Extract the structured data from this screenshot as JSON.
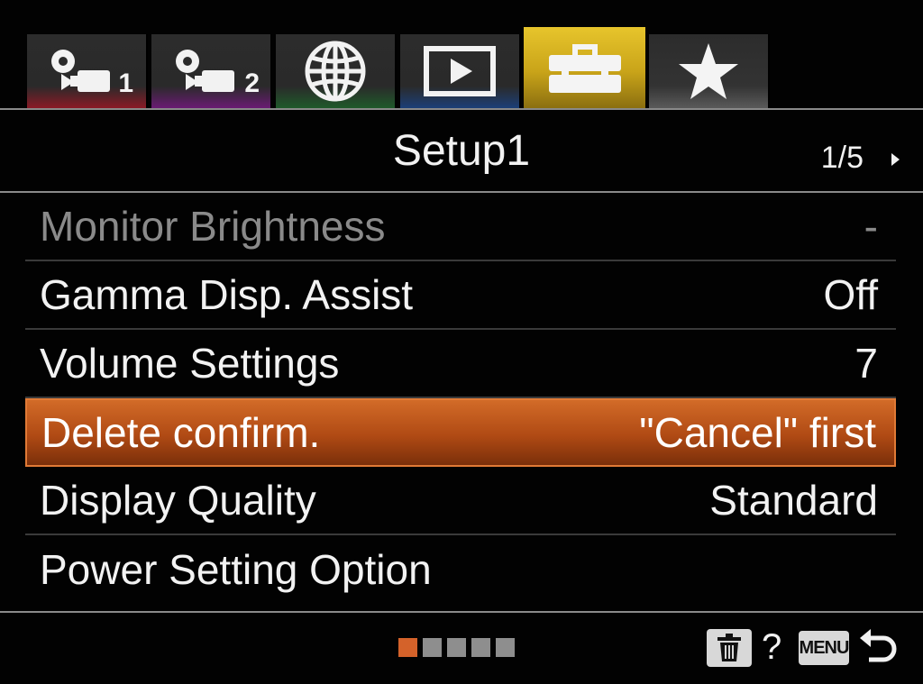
{
  "tabs": [
    {
      "icon": "camera-settings-icon",
      "number": "1",
      "color": "#8b1a26"
    },
    {
      "icon": "camera-settings-icon",
      "number": "2",
      "color": "#6a1b73"
    },
    {
      "icon": "globe-icon",
      "number": "",
      "color": "#1f5a2a"
    },
    {
      "icon": "playback-icon",
      "number": "",
      "color": "#1c3f78"
    },
    {
      "icon": "toolbox-icon",
      "number": "",
      "color": "#e7c52c",
      "active": true
    },
    {
      "icon": "star-icon",
      "number": "",
      "color": "#5a5a5a"
    }
  ],
  "header": {
    "title": "Setup1",
    "page": "1/5"
  },
  "menu": {
    "items": [
      {
        "label": "Monitor Brightness",
        "value": "-",
        "state": "disabled"
      },
      {
        "label": "Gamma Disp. Assist",
        "value": "Off",
        "state": "normal"
      },
      {
        "label": "Volume Settings",
        "value": "7",
        "state": "normal"
      },
      {
        "label": "Delete confirm.",
        "value": "\"Cancel\" first",
        "state": "selected"
      },
      {
        "label": "Display Quality",
        "value": "Standard",
        "state": "normal"
      },
      {
        "label": "Power Setting Option",
        "value": "",
        "state": "normal"
      }
    ]
  },
  "footer": {
    "pages_total": 5,
    "pages_current": 1,
    "help": "?",
    "menu_button": "MENU",
    "trash_icon": "trash-icon",
    "back_icon": "return-icon"
  },
  "colors": {
    "accent_selected": "#c45a1e",
    "active_tab": "#e7c52c",
    "disabled_text": "#8a8a8a"
  }
}
